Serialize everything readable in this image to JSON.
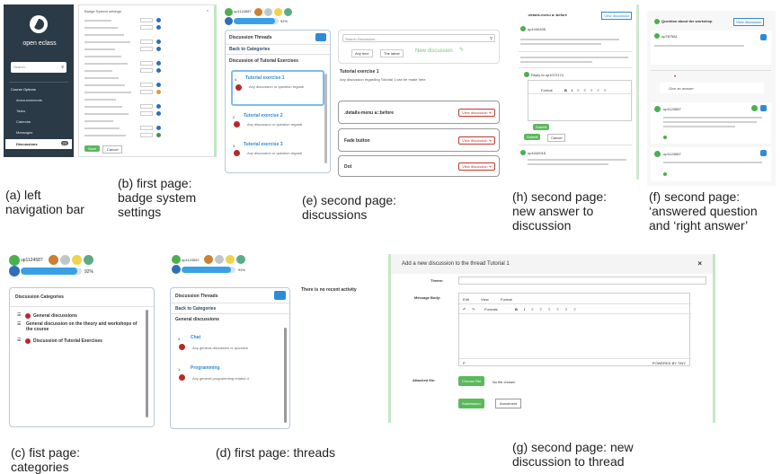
{
  "captions": {
    "a": "(a) left\nnavigation bar",
    "b": "(b) first page:\nbadge system\nsettings",
    "c": "(c) fist page:\ncategories",
    "d": "(d) first page: threads",
    "e": "(e) second page:\ndiscussions",
    "f": "(f) second page:\n‘answered question\nand ‘right answer’",
    "g": "(g) second page: new\ndiscussion to thread",
    "h": "(h) second page:\nnew answer to\ndiscussion"
  },
  "nav": {
    "logo_text": "open eclass",
    "search_placeholder": "Search...",
    "section": "Course Options",
    "items": [
      "Announcements",
      "Tasks",
      "Calendar",
      "Messages",
      "Discussions"
    ],
    "badge": "23"
  },
  "badge_settings": {
    "title": "Badge System settings",
    "save_label": "Save",
    "cancel_label": "Cancel"
  },
  "user": {
    "name": "up1124587",
    "progress_label": "92%",
    "progress": 0.92,
    "level": "2"
  },
  "categories": {
    "title": "Discussion Categories",
    "items": [
      {
        "count": "4",
        "label": "General discussions"
      },
      {
        "count": "",
        "label": "General discussion on the theory and workshops of the course"
      },
      {
        "count": "6",
        "label": "Discussion of Tutorial Exercises"
      }
    ]
  },
  "threads": {
    "title": "Discussion Threads",
    "back": "Back to Categories",
    "section": "General discussions",
    "empty_note": "There is no recent activity",
    "items": [
      {
        "count": "4",
        "title": "Chat",
        "desc": "Any general discussion or question",
        "badge": "4"
      },
      {
        "count": "1",
        "title": "Programming",
        "desc": "Any general programming related d",
        "badge": "1"
      }
    ]
  },
  "discussions": {
    "title": "Discussion Threads",
    "back": "Back to Categories",
    "section": "Discussion of Tutorial Exercises",
    "search_placeholder": "Search Discussion...",
    "filter_all": "Any time",
    "filter_sort": "The latest",
    "new_discussion": "New discussion",
    "thread_title": "Tutorial exercise 1",
    "thread_desc": "Any discussion regarding Tutorial 1 can be made here",
    "items": [
      {
        "count": "4",
        "title": "Tutorial exercise 1",
        "desc": "Any discussion or question regardi",
        "badge": "4"
      },
      {
        "count": "2",
        "title": "Tutorial exercise 2",
        "desc": "Any discussion or question regardi",
        "badge": "2"
      },
      {
        "count": "3",
        "title": "Tutorial exercise 3",
        "desc": "Any discussion or question regardi",
        "badge": "3"
      }
    ],
    "cards": [
      {
        "title": ".details-menu a::before",
        "button": "View discussion"
      },
      {
        "title": "Fade button",
        "button": "View discussion"
      },
      {
        "title": "Dot",
        "button": "View discussion"
      }
    ]
  },
  "answer": {
    "title": ".details-menu a::before",
    "view_button": "View discussion",
    "user1": "up1040405",
    "reply_to": "Reply to up1072174",
    "format_label": "Format",
    "submit": "Submit",
    "cancel": "Cancel",
    "user2": "up1042015"
  },
  "answered": {
    "title": "Question about the workshop",
    "view_button": "View discussion",
    "user1": "up787581",
    "user2": "up1124587",
    "user3": "up1124587",
    "answer_label": "Give an answer"
  },
  "new_discussion": {
    "header": "Add a new discussion to the thread Tutorial 1",
    "close": "×",
    "theme_label": "Theme:",
    "body_label": "Message Body:",
    "menu": [
      "Edit",
      "View",
      "Format"
    ],
    "formats_label": "Formats",
    "editor_footer_left": "P",
    "editor_footer_right": "POWERED BY TINY",
    "attached_label": "Attached file:",
    "choose_file": "Choose File",
    "no_file": "No file chosen",
    "submit": "Submission",
    "cancel": "Annulment"
  },
  "colors": {
    "accent": "#2e8bd6",
    "danger": "#c0392b",
    "success": "#5cb85c",
    "nav_bg": "#2b3a47"
  }
}
